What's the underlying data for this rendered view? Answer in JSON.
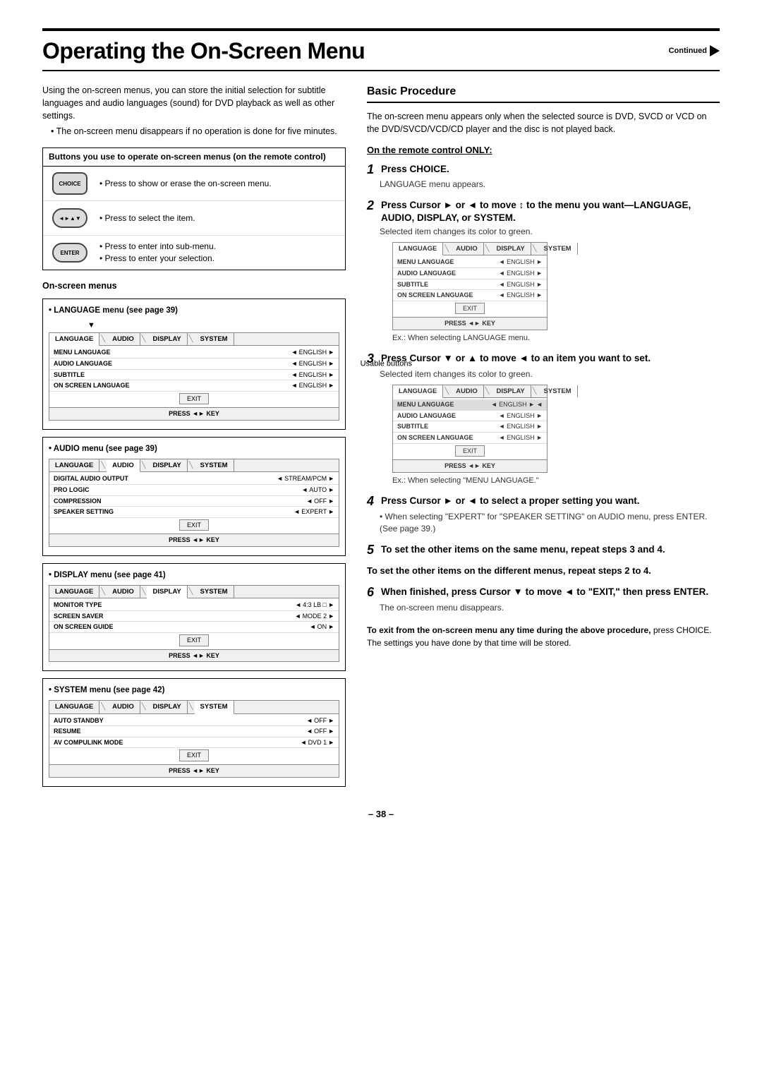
{
  "page": {
    "title": "Operating the On-Screen Menu",
    "continued": "Continued",
    "page_number": "– 38 –"
  },
  "intro": {
    "text1": "Using the on-screen menus, you can store the initial selection for subtitle languages and audio languages (sound) for DVD playback as well as other settings.",
    "text2": "• The on-screen menu disappears if no operation is done for five minutes."
  },
  "buttons_section": {
    "title": "Buttons you use to operate on-screen menus (on the remote control)",
    "rows": [
      {
        "desc": "• Press to show or erase the on-screen menu."
      },
      {
        "desc": "• Press to select the item."
      },
      {
        "desc_multi": [
          "• Press to enter into sub-menu.",
          "• Press to enter your selection."
        ]
      }
    ]
  },
  "onscreen_menus": {
    "title": "On-screen menus",
    "menus": [
      {
        "label": "• LANGUAGE menu (see page 39)",
        "tabs": [
          "LANGUAGE",
          "AUDIO",
          "DISPLAY",
          "SYSTEM"
        ],
        "active_tab": "LANGUAGE",
        "rows": [
          {
            "label": "MENU LANGUAGE",
            "value": "ENGLISH"
          },
          {
            "label": "AUDIO LANGUAGE",
            "value": "ENGLISH"
          },
          {
            "label": "SUBTITLE",
            "value": "ENGLISH"
          },
          {
            "label": "ON SCREEN LANGUAGE",
            "value": "ENGLISH"
          }
        ],
        "footer": "PRESS ◄► KEY",
        "usable_buttons": true
      },
      {
        "label": "• AUDIO menu (see page 39)",
        "tabs": [
          "LANGUAGE",
          "AUDIO",
          "DISPLAY",
          "SYSTEM"
        ],
        "active_tab": "AUDIO",
        "rows": [
          {
            "label": "DIGITAL AUDIO OUTPUT",
            "value": "STREAM/PCM ►"
          },
          {
            "label": "PRO LOGIC",
            "value": "AUTO"
          },
          {
            "label": "COMPRESSION",
            "value": "OFF"
          },
          {
            "label": "SPEAKER SETTING",
            "value": "EXPERT"
          }
        ],
        "footer": "PRESS ◄► KEY"
      },
      {
        "label": "• DISPLAY menu (see page 41)",
        "tabs": [
          "LANGUAGE",
          "AUDIO",
          "DISPLAY",
          "SYSTEM"
        ],
        "active_tab": "DISPLAY",
        "rows": [
          {
            "label": "MONITOR TYPE",
            "value": "4:3 LB □ ►"
          },
          {
            "label": "SCREEN SAVER",
            "value": "MODE 2"
          },
          {
            "label": "ON SCREEN GUIDE",
            "value": "ON"
          }
        ],
        "footer": "PRESS ◄► KEY"
      },
      {
        "label": "• SYSTEM menu (see page 42)",
        "tabs": [
          "LANGUAGE",
          "AUDIO",
          "DISPLAY",
          "SYSTEM"
        ],
        "active_tab": "SYSTEM",
        "rows": [
          {
            "label": "AUTO STANDBY",
            "value": "OFF"
          },
          {
            "label": "RESUME",
            "value": "OFF"
          },
          {
            "label": "AV COMPULINK MODE",
            "value": "DVD 1"
          }
        ],
        "footer": "PRESS ◄► KEY"
      }
    ]
  },
  "basic_procedure": {
    "title": "Basic Procedure",
    "intro": "The on-screen menu appears only when the selected source is DVD, SVCD or VCD on the DVD/SVCD/VCD/CD player and the disc is not played back.",
    "remote_only_label": "On the remote control ONLY:",
    "steps": [
      {
        "number": "1",
        "title": "Press CHOICE.",
        "body": "LANGUAGE menu appears."
      },
      {
        "number": "2",
        "title": "Press Cursor ► or ◄ to move ↕ to the menu you want—LANGUAGE, AUDIO, DISPLAY, or SYSTEM.",
        "body": "Selected item changes its color to green.",
        "has_screen": true,
        "screen_ex": "Ex.: When selecting LANGUAGE menu."
      },
      {
        "number": "3",
        "title": "Press Cursor ▼ or ▲ to move ◄ to an item you want to set.",
        "body": "Selected item changes its color to green.",
        "has_screen2": true,
        "screen_ex2": "Ex.: When selecting \"MENU LANGUAGE.\""
      },
      {
        "number": "4",
        "title": "Press Cursor ► or ◄ to select a proper setting you want.",
        "body": "• When selecting \"EXPERT\" for \"SPEAKER SETTING\" on AUDIO menu, press ENTER. (See page 39.)"
      },
      {
        "number": "5",
        "title": "To set the other items on the same menu, repeat steps 3 and 4."
      },
      {
        "number": "",
        "title": "To set the other items on the different menus, repeat steps 2 to 4."
      },
      {
        "number": "6",
        "title": "When finished, press Cursor ▼ to move ◄ to \"EXIT,\" then press ENTER.",
        "body": "The on-screen menu disappears."
      }
    ],
    "note": {
      "bold_part": "To exit from the on-screen menu any time during the above procedure,",
      "normal_part": " press CHOICE. The settings you have done by that time will be stored."
    }
  },
  "screen_diagrams": {
    "diagram1": {
      "tabs": [
        "LANGUAGE",
        "AUDIO",
        "DISPLAY",
        "SYSTEM"
      ],
      "active_tab": "LANGUAGE",
      "rows": [
        {
          "label": "MENU LANGUAGE",
          "value": "ENGLISH"
        },
        {
          "label": "AUDIO LANGUAGE",
          "value": "ENGLISH"
        },
        {
          "label": "SUBTITLE",
          "value": "ENGLISH"
        },
        {
          "label": "ON SCREEN LANGUAGE",
          "value": "ENGLISH"
        }
      ],
      "footer": "PRESS ◄► KEY"
    },
    "diagram2": {
      "tabs": [
        "LANGUAGE",
        "AUDIO",
        "DISPLAY",
        "SYSTEM"
      ],
      "active_tab": "LANGUAGE",
      "rows": [
        {
          "label": "MENU LANGUAGE",
          "value": "ENGLISH",
          "highlighted": true
        },
        {
          "label": "AUDIO LANGUAGE",
          "value": "ENGLISH"
        },
        {
          "label": "SUBTITLE",
          "value": "ENGLISH"
        },
        {
          "label": "ON SCREEN LANGUAGE",
          "value": "ENGLISH"
        }
      ],
      "footer": "PRESS ◄► KEY"
    }
  }
}
